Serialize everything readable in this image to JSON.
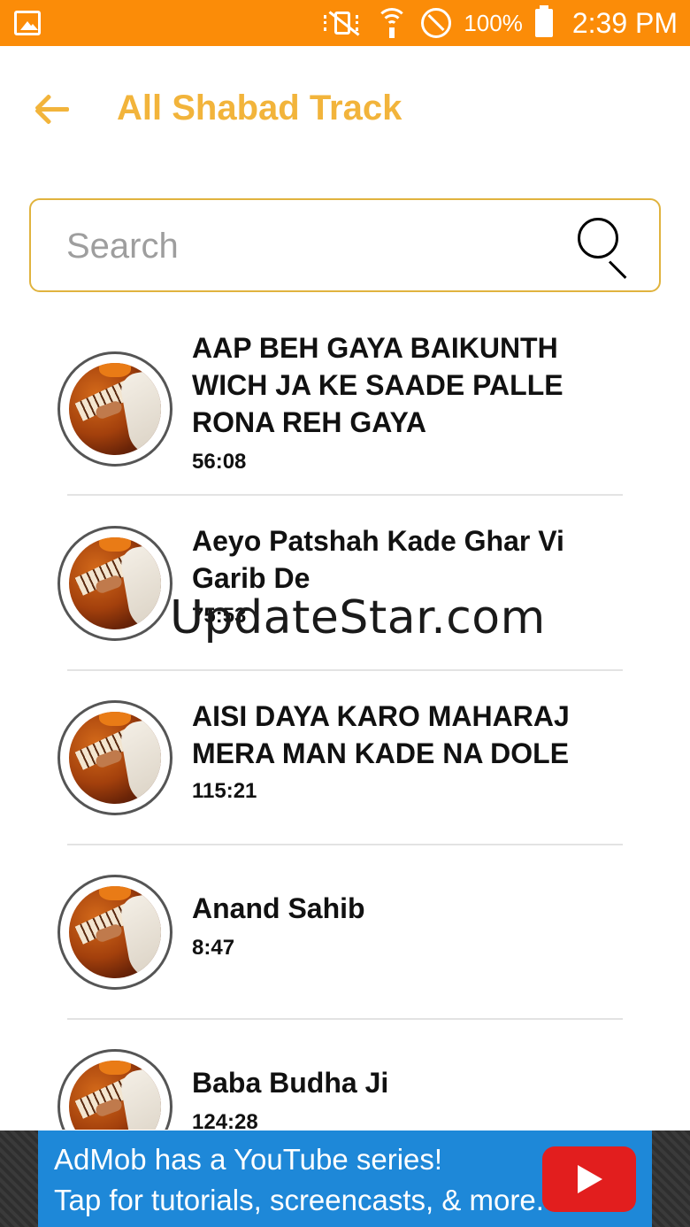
{
  "status_bar": {
    "battery": "100%",
    "time": "2:39 PM",
    "icons": [
      "gallery-icon",
      "vibrate-off-icon",
      "wifi-icon",
      "do-not-disturb-icon",
      "battery-icon"
    ]
  },
  "header": {
    "title": "All Shabad Track",
    "back_icon": "back-arrow-icon"
  },
  "search": {
    "placeholder": "Search",
    "value": ""
  },
  "tracks": [
    {
      "title": "AAP BEH GAYA BAIKUNTH WICH JA KE SAADE PALLE RONA REH GAYA",
      "duration": "56:08"
    },
    {
      "title": "Aeyo Patshah Kade Ghar Vi Garib De",
      "duration": "75:53"
    },
    {
      "title": "AISI DAYA KARO MAHARAJ MERA MAN KADE NA DOLE",
      "duration": "115:21"
    },
    {
      "title": "Anand Sahib",
      "duration": "8:47"
    },
    {
      "title": "Baba Budha Ji",
      "duration": "124:28"
    }
  ],
  "watermark": "UpdateStar.com",
  "ad": {
    "line1": "AdMob has a YouTube series!",
    "line2": "Tap for tutorials, screencasts, & more."
  },
  "colors": {
    "status_bar": "#fb8c08",
    "accent": "#f2b43b",
    "search_border": "#e0b33e",
    "ad_background": "#1e88d8"
  }
}
